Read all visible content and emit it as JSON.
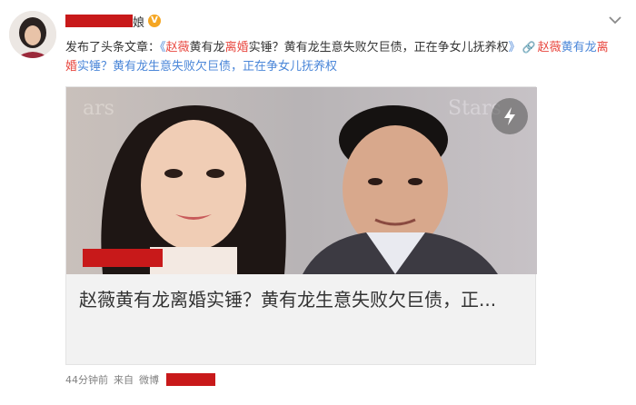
{
  "user": {
    "name_visible_tail": "娘",
    "verified_badge": "V"
  },
  "post": {
    "prefix": "发布了头条文章：",
    "quote_open": "《",
    "seg1_red": "赵薇",
    "seg2": "黄有龙",
    "seg3_red": "离婚",
    "seg4": "实锤？黄有龙生意失败欠巨债，正在争女儿抚养权",
    "quote_close": "》",
    "link_icon": "link-icon",
    "link_seg1_red": "赵薇",
    "link_seg2": "黄有龙",
    "link_seg3_red": "离婚",
    "link_seg4": "实锤？黄有龙生意失败欠巨债，正在争女儿抚养权"
  },
  "card": {
    "title": "赵薇黄有龙离婚实锤？黄有龙生意失败欠巨债，正..."
  },
  "meta": {
    "time": "44分钟前",
    "source_prefix": "来自",
    "source": "微博"
  },
  "colors": {
    "highlight_red": "#e8473f",
    "link_blue": "#4a86d8",
    "redaction": "#c8191a",
    "badge": "#f5a623"
  }
}
